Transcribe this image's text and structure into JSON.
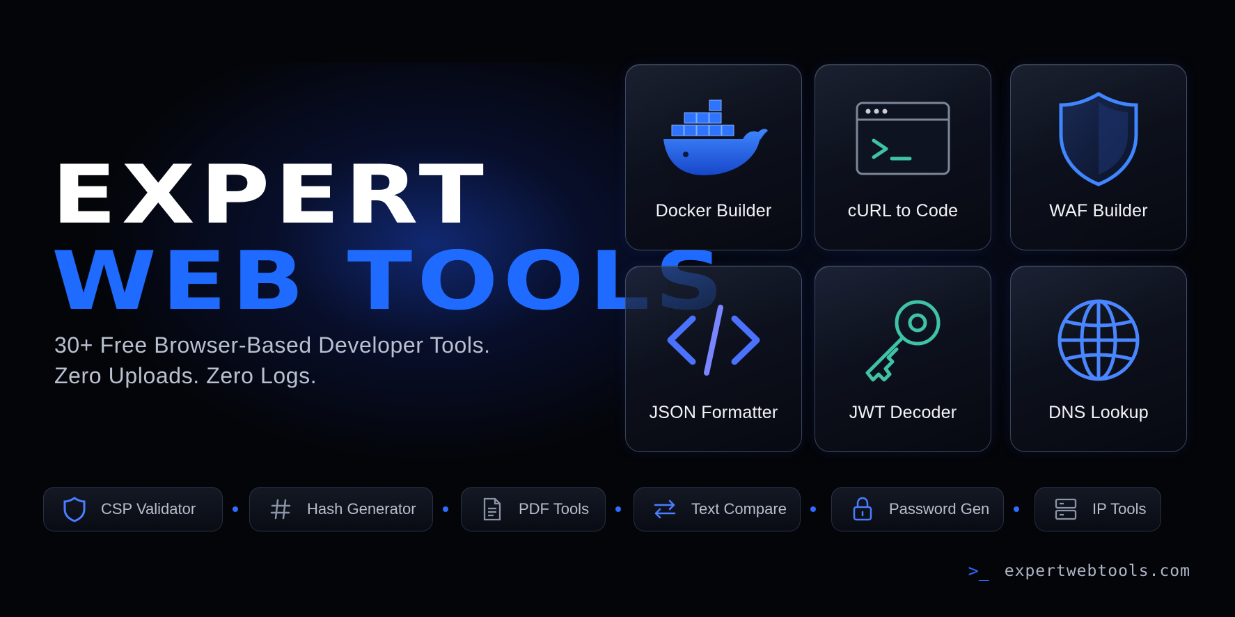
{
  "hero": {
    "title_line1": "EXPERT",
    "title_line2": "WEB TOOLS",
    "subtitle_line1": "30+ Free Browser-Based Developer Tools.",
    "subtitle_line2": "Zero Uploads. Zero Logs."
  },
  "tool_cards": [
    {
      "label": "Docker Builder",
      "icon": "docker-whale-icon"
    },
    {
      "label": "cURL to Code",
      "icon": "terminal-window-icon"
    },
    {
      "label": "WAF Builder",
      "icon": "shield-icon"
    },
    {
      "label": "JSON Formatter",
      "icon": "code-brackets-icon"
    },
    {
      "label": "JWT Decoder",
      "icon": "key-icon"
    },
    {
      "label": "DNS Lookup",
      "icon": "globe-icon"
    }
  ],
  "feature_pills": [
    {
      "label": "CSP Validator",
      "icon": "shield-outline-icon"
    },
    {
      "label": "Hash Generator",
      "icon": "hash-icon"
    },
    {
      "label": "PDF Tools",
      "icon": "document-icon"
    },
    {
      "label": "Text Compare",
      "icon": "swap-arrows-icon"
    },
    {
      "label": "Password Gen",
      "icon": "lock-icon"
    },
    {
      "label": "IP Tools",
      "icon": "server-icon"
    }
  ],
  "footer": {
    "prompt": ">_",
    "url": "expertwebtools.com"
  },
  "colors": {
    "background": "#040509",
    "accent_blue": "#1f6bff",
    "teal": "#3fc2a6",
    "text_white": "#ffffff",
    "text_muted": "#b9c0cf"
  }
}
